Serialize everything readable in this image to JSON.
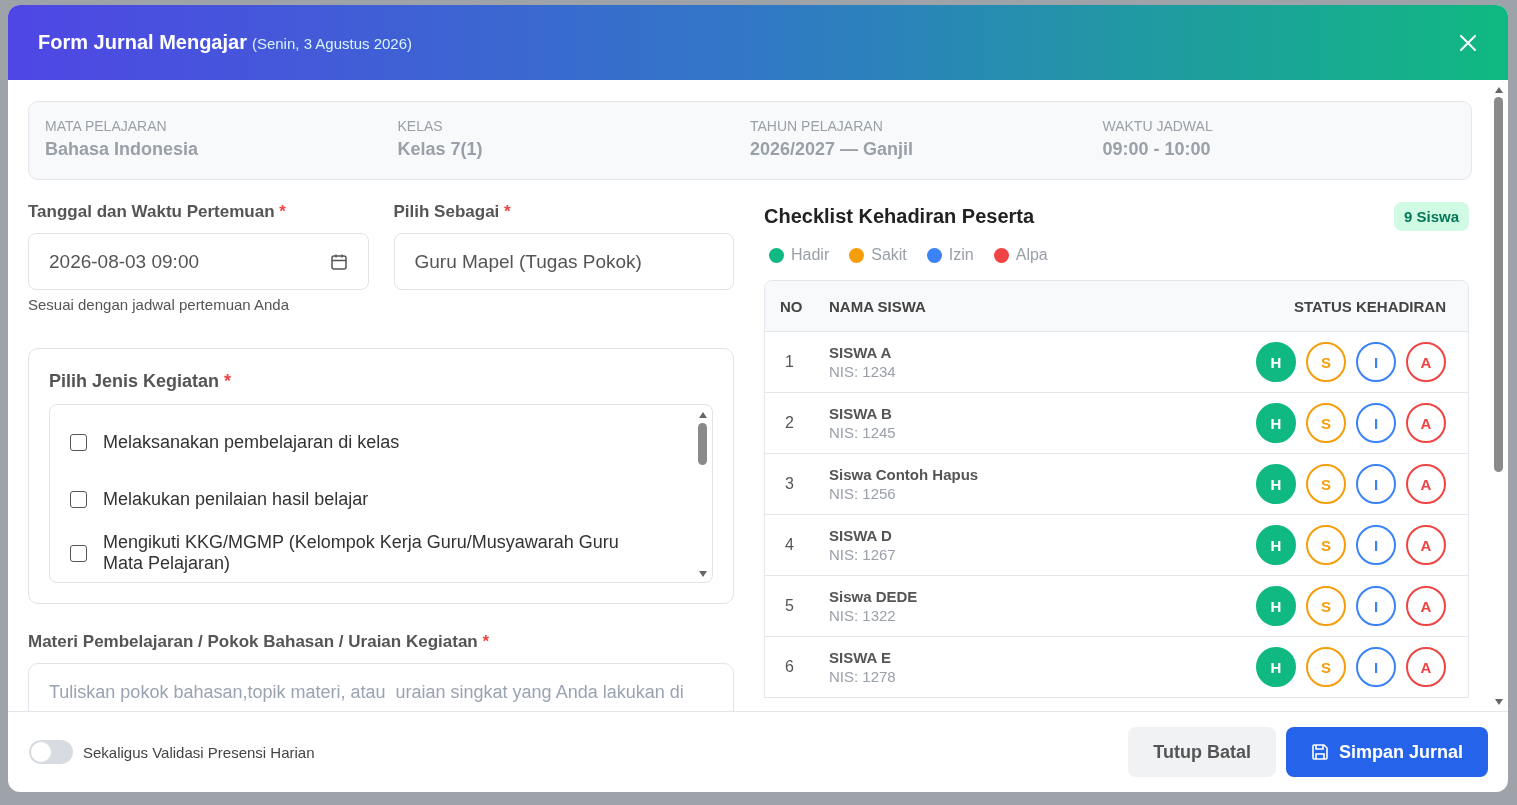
{
  "dialog": {
    "title": "Form Jurnal Mengajar",
    "subtitle": "(Senin, 3 Agustus 2026)"
  },
  "info": [
    {
      "label": "MATA PELAJARAN",
      "value": "Bahasa Indonesia"
    },
    {
      "label": "KELAS",
      "value": "Kelas 7(1)"
    },
    {
      "label": "TAHUN PELAJARAN",
      "value": "2026/2027 — Ganjil"
    },
    {
      "label": "WAKTU JADWAL",
      "value": "09:00 - 10:00"
    }
  ],
  "date_field": {
    "label": "Tanggal dan Waktu Pertemuan",
    "required": "*",
    "value": "2026-08-03 09:00",
    "hint": "Sesuai dengan jadwal pertemuan Anda"
  },
  "role_field": {
    "label": "Pilih Sebagai",
    "required": "*",
    "value": "Guru Mapel (Tugas Pokok)"
  },
  "activities": {
    "label": "Pilih Jenis Kegiatan",
    "required": "*",
    "items": [
      {
        "label": "Melaksanakan pembelajaran di kelas",
        "checked": false
      },
      {
        "label": "Melakukan penilaian hasil belajar",
        "checked": false
      },
      {
        "label": "Mengikuti KKG/MGMP (Kelompok Kerja Guru/Musyawarah Guru Mata Pelajaran)",
        "checked": false
      }
    ]
  },
  "material": {
    "label": "Materi Pembelajaran / Pokok Bahasan / Uraian Kegiatan",
    "required": "*",
    "placeholder": "Tuliskan pokok bahasan,topik materi, atau  uraian singkat yang Anda lakukan di"
  },
  "attendance": {
    "title": "Checklist Kehadiran Peserta",
    "count": "9 Siswa",
    "legend": [
      {
        "label": "Hadir",
        "color": "#10b981"
      },
      {
        "label": "Sakit",
        "color": "#f59e0b"
      },
      {
        "label": "Izin",
        "color": "#3b82f6"
      },
      {
        "label": "Alpa",
        "color": "#ef4444"
      }
    ],
    "columns": [
      "NO",
      "NAMA SISWA",
      "STATUS KEHADIRAN"
    ],
    "rows": [
      {
        "no": "1",
        "name": "SISWA A",
        "nis": "NIS: 1234",
        "options": [
          {
            "label": "H",
            "selected": true
          },
          {
            "label": "S",
            "selected": false
          },
          {
            "label": "I",
            "selected": false
          },
          {
            "label": "A",
            "selected": false
          }
        ]
      },
      {
        "no": "2",
        "name": "SISWA B",
        "nis": "NIS: 1245",
        "options": [
          {
            "label": "H",
            "selected": true
          },
          {
            "label": "S",
            "selected": false
          },
          {
            "label": "I",
            "selected": false
          },
          {
            "label": "A",
            "selected": false
          }
        ]
      },
      {
        "no": "3",
        "name": "Siswa Contoh Hapus",
        "nis": "NIS: 1256",
        "options": [
          {
            "label": "H",
            "selected": true
          },
          {
            "label": "S",
            "selected": false
          },
          {
            "label": "I",
            "selected": false
          },
          {
            "label": "A",
            "selected": false
          }
        ]
      },
      {
        "no": "4",
        "name": "SISWA D",
        "nis": "NIS: 1267",
        "options": [
          {
            "label": "H",
            "selected": true
          },
          {
            "label": "S",
            "selected": false
          },
          {
            "label": "I",
            "selected": false
          },
          {
            "label": "A",
            "selected": false
          }
        ]
      },
      {
        "no": "5",
        "name": "Siswa DEDE",
        "nis": "NIS: 1322",
        "options": [
          {
            "label": "H",
            "selected": true
          },
          {
            "label": "S",
            "selected": false
          },
          {
            "label": "I",
            "selected": false
          },
          {
            "label": "A",
            "selected": false
          }
        ]
      },
      {
        "no": "6",
        "name": "SISWA E",
        "nis": "NIS: 1278",
        "options": [
          {
            "label": "H",
            "selected": true
          },
          {
            "label": "S",
            "selected": false
          },
          {
            "label": "I",
            "selected": false
          },
          {
            "label": "A",
            "selected": false
          }
        ]
      }
    ]
  },
  "footer": {
    "toggle": {
      "label": "Sekaligus Validasi Presensi Harian",
      "on": false
    },
    "buttons": [
      "Tutup Batal",
      "Simpan Jurnal"
    ]
  }
}
